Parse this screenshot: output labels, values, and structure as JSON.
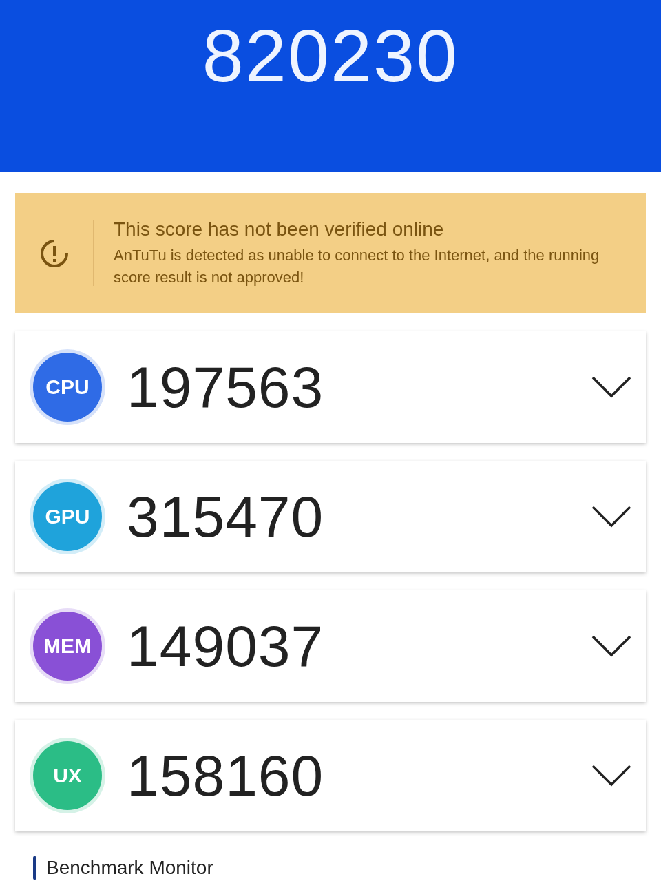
{
  "total_score": "820230",
  "warning": {
    "title": "This score has not been verified online",
    "message": "AnTuTu is detected as unable to connect to the Internet, and the running score result is not approved!"
  },
  "categories": [
    {
      "badge": "CPU",
      "score": "197563",
      "color": "#2f6be6"
    },
    {
      "badge": "GPU",
      "score": "315470",
      "color": "#1fa3db"
    },
    {
      "badge": "MEM",
      "score": "149037",
      "color": "#8950d6"
    },
    {
      "badge": "UX",
      "score": "158160",
      "color": "#2bbd86"
    }
  ],
  "footer": {
    "label": "Benchmark Monitor"
  }
}
